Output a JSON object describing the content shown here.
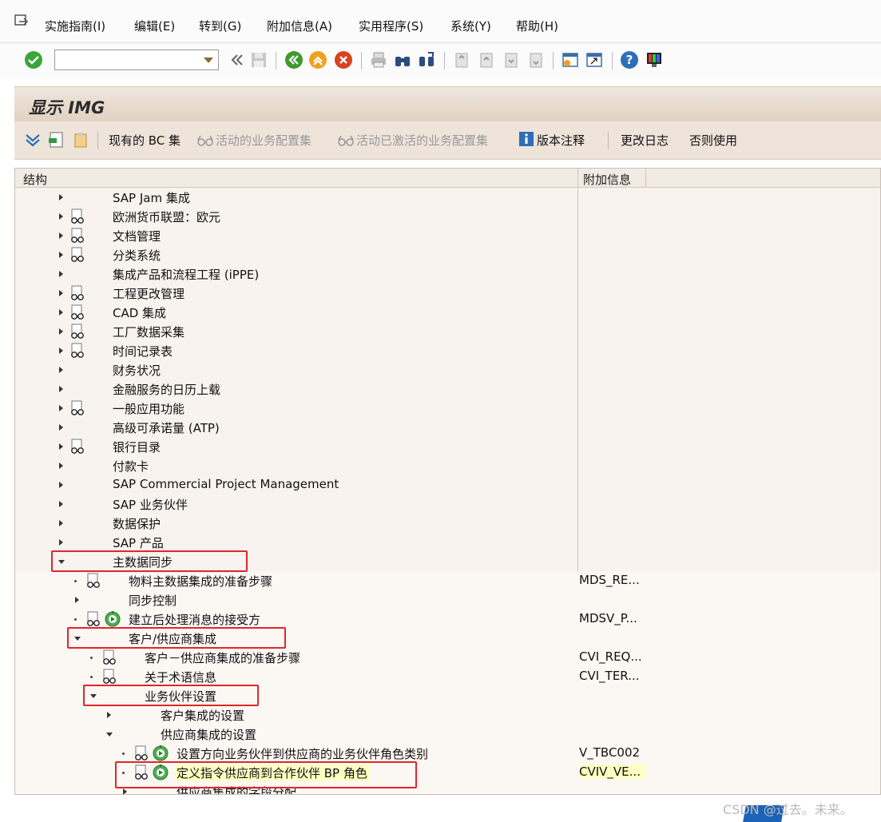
{
  "menu": [
    "实施指南(I)",
    "编辑(E)",
    "转到(G)",
    "附加信息(A)",
    "实用程序(S)",
    "系统(Y)",
    "帮助(H)"
  ],
  "title": "显示 IMG",
  "app_toolbar": {
    "bc_sets": "现有的 BC 集",
    "active_bc_sets": "活动的业务配置集",
    "activated_bc_sets": "活动已激活的业务配置集",
    "release_notes": "版本注释",
    "change_log": "更改日志",
    "otherwise_used": "否则使用"
  },
  "columns": {
    "structure": "结构",
    "additional_info": "附加信息"
  },
  "tree": [
    {
      "label": "SAP Jam 集成",
      "level": 0,
      "node": "collapsed",
      "doc": false,
      "exec": false,
      "info": ""
    },
    {
      "label": "欧洲货币联盟：欧元",
      "level": 0,
      "node": "collapsed",
      "doc": true,
      "exec": false,
      "info": ""
    },
    {
      "label": "文档管理",
      "level": 0,
      "node": "collapsed",
      "doc": true,
      "exec": false,
      "info": ""
    },
    {
      "label": "分类系统",
      "level": 0,
      "node": "collapsed",
      "doc": true,
      "exec": false,
      "info": ""
    },
    {
      "label": "集成产品和流程工程 (iPPE)",
      "level": 0,
      "node": "collapsed",
      "doc": false,
      "exec": false,
      "info": ""
    },
    {
      "label": "工程更改管理",
      "level": 0,
      "node": "collapsed",
      "doc": true,
      "exec": false,
      "info": ""
    },
    {
      "label": "CAD 集成",
      "level": 0,
      "node": "collapsed",
      "doc": true,
      "exec": false,
      "info": ""
    },
    {
      "label": "工厂数据采集",
      "level": 0,
      "node": "collapsed",
      "doc": true,
      "exec": false,
      "info": ""
    },
    {
      "label": "时间记录表",
      "level": 0,
      "node": "collapsed",
      "doc": true,
      "exec": false,
      "info": ""
    },
    {
      "label": "财务状况",
      "level": 0,
      "node": "collapsed",
      "doc": false,
      "exec": false,
      "info": ""
    },
    {
      "label": "金融服务的日历上载",
      "level": 0,
      "node": "collapsed",
      "doc": false,
      "exec": false,
      "info": ""
    },
    {
      "label": "一般应用功能",
      "level": 0,
      "node": "collapsed",
      "doc": true,
      "exec": false,
      "info": ""
    },
    {
      "label": "高级可承诺量 (ATP)",
      "level": 0,
      "node": "collapsed",
      "doc": false,
      "exec": false,
      "info": ""
    },
    {
      "label": "银行目录",
      "level": 0,
      "node": "collapsed",
      "doc": true,
      "exec": false,
      "info": ""
    },
    {
      "label": "付款卡",
      "level": 0,
      "node": "collapsed",
      "doc": false,
      "exec": false,
      "info": ""
    },
    {
      "label": "SAP Commercial Project Management",
      "level": 0,
      "node": "collapsed",
      "doc": false,
      "exec": false,
      "info": ""
    },
    {
      "label": "SAP 业务伙伴",
      "level": 0,
      "node": "collapsed",
      "doc": false,
      "exec": false,
      "info": ""
    },
    {
      "label": "数据保护",
      "level": 0,
      "node": "collapsed",
      "doc": false,
      "exec": false,
      "info": ""
    },
    {
      "label": "SAP 产品",
      "level": 0,
      "node": "collapsed",
      "doc": false,
      "exec": false,
      "info": ""
    },
    {
      "label": "主数据同步",
      "level": 0,
      "node": "expanded",
      "doc": false,
      "exec": false,
      "info": "",
      "highlight": true
    },
    {
      "label": "物料主数据集成的准备步骤",
      "level": 1,
      "node": "leaf",
      "doc": true,
      "exec": false,
      "info": "MDS_RE..."
    },
    {
      "label": "同步控制",
      "level": 1,
      "node": "collapsed",
      "doc": false,
      "exec": false,
      "info": ""
    },
    {
      "label": "建立后处理消息的接受方",
      "level": 1,
      "node": "leaf",
      "doc": true,
      "exec": true,
      "info": "MDSV_P..."
    },
    {
      "label": "客户/供应商集成",
      "level": 1,
      "node": "expanded",
      "doc": false,
      "exec": false,
      "info": "",
      "highlight": true
    },
    {
      "label": "客户－供应商集成的准备步骤",
      "level": 2,
      "node": "leaf",
      "doc": true,
      "exec": false,
      "info": "CVI_REQ..."
    },
    {
      "label": "关于术语信息",
      "level": 2,
      "node": "leaf",
      "doc": true,
      "exec": false,
      "info": "CVI_TER..."
    },
    {
      "label": "业务伙伴设置",
      "level": 2,
      "node": "expanded",
      "doc": false,
      "exec": false,
      "info": "",
      "highlight": true
    },
    {
      "label": "客户集成的设置",
      "level": 3,
      "node": "collapsed",
      "doc": false,
      "exec": false,
      "info": ""
    },
    {
      "label": "供应商集成的设置",
      "level": 3,
      "node": "expanded",
      "doc": false,
      "exec": false,
      "info": ""
    },
    {
      "label": "设置方向业务伙伴到供应商的业务伙伴角色类别",
      "level": 4,
      "node": "leaf",
      "doc": true,
      "exec": true,
      "info": "V_TBC002"
    },
    {
      "label": "定义指令供应商到合作伙伴 BP 角色",
      "level": 4,
      "node": "leaf",
      "doc": true,
      "exec": true,
      "info": "CVIV_VE...",
      "selected": true,
      "highlight": true
    },
    {
      "label": "供应商集成的字段分配",
      "level": 4,
      "node": "collapsed",
      "doc": false,
      "exec": false,
      "info": ""
    }
  ],
  "watermark": "CSDN @过去。未来。"
}
